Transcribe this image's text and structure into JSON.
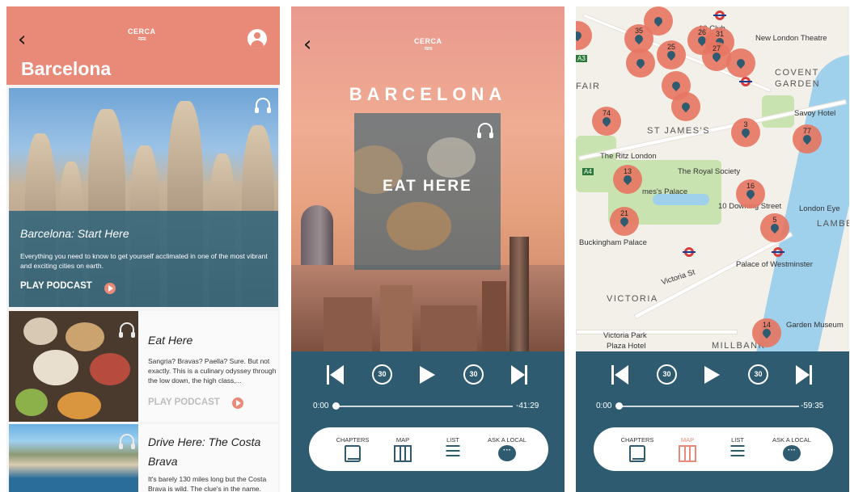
{
  "screen1": {
    "logo": "CERCA",
    "city_title": "Barcelona",
    "featured": {
      "title": "Barcelona: Start Here",
      "description": "Everything you need to know to get yourself acclimated in one of the most vibrant and exciting cities on earth.",
      "cta": "PLAY PODCAST"
    },
    "cards": [
      {
        "title": "Eat Here",
        "description": "Sangria? Bravas? Paella? Sure. But not exactly. This is a culinary odyssey through the low down, the high class,...",
        "cta": "PLAY PODCAST"
      },
      {
        "title": "Drive Here: The Costa Brava",
        "description": "It's barely 130 miles long but the Costa Brava is wild. The clue's in the name."
      }
    ]
  },
  "screen2": {
    "logo": "CERCA",
    "city_heading": "BARCELONA",
    "episode_label": "EAT HERE",
    "player": {
      "current_time": "0:00",
      "remaining_time": "-41:29",
      "progress": 0.01,
      "skip_back": "30",
      "skip_forward": "30"
    },
    "tabs": [
      {
        "label": "CHAPTERS",
        "icon": "book-icon"
      },
      {
        "label": "MAP",
        "icon": "map-icon"
      },
      {
        "label": "LIST",
        "icon": "list-icon"
      },
      {
        "label": "ASK A LOCAL",
        "icon": "chat-bubble-icon"
      }
    ]
  },
  "screen3": {
    "map_labels": {
      "club": "10 Club",
      "theatre": "New London Theatre",
      "covent": "COVENT",
      "garden": "GARDEN",
      "fair": "FAIR",
      "savoy": "Savoy Hotel",
      "jamess": "ST JAMES'S",
      "ritz": "The Ritz London",
      "royal": "The Royal Society",
      "palace": "mes's Palace",
      "downing": "10 Downing Street",
      "eye": "London Eye",
      "lambe": "LAMBE",
      "buckingham": "Buckingham Palace",
      "westminster": "Palace of Westminster",
      "victoria": "VICTORIA",
      "victoria_st": "Victoria St",
      "victoria_park": "Victoria Park",
      "plaza": "Plaza Hotel",
      "garden_museum": "Garden Museum",
      "millbank": "MILLBANK",
      "a4": "A4",
      "a3": "A3"
    },
    "pins": [
      "35",
      "26",
      "31",
      "27",
      "25",
      "74",
      "3",
      "77",
      "13",
      "16",
      "21",
      "5",
      "14"
    ],
    "player": {
      "current_time": "0:00",
      "remaining_time": "-59:35",
      "progress": 0.01,
      "skip_back": "30",
      "skip_forward": "30"
    },
    "tabs": [
      {
        "label": "CHAPTERS",
        "icon": "book-icon"
      },
      {
        "label": "MAP",
        "icon": "map-icon"
      },
      {
        "label": "LIST",
        "icon": "list-icon"
      },
      {
        "label": "ASK A LOCAL",
        "icon": "chat-bubble-icon"
      }
    ],
    "active_tab": "MAP"
  },
  "colors": {
    "coral": "#e98a78",
    "teal": "#2f5b70",
    "white": "#ffffff"
  }
}
